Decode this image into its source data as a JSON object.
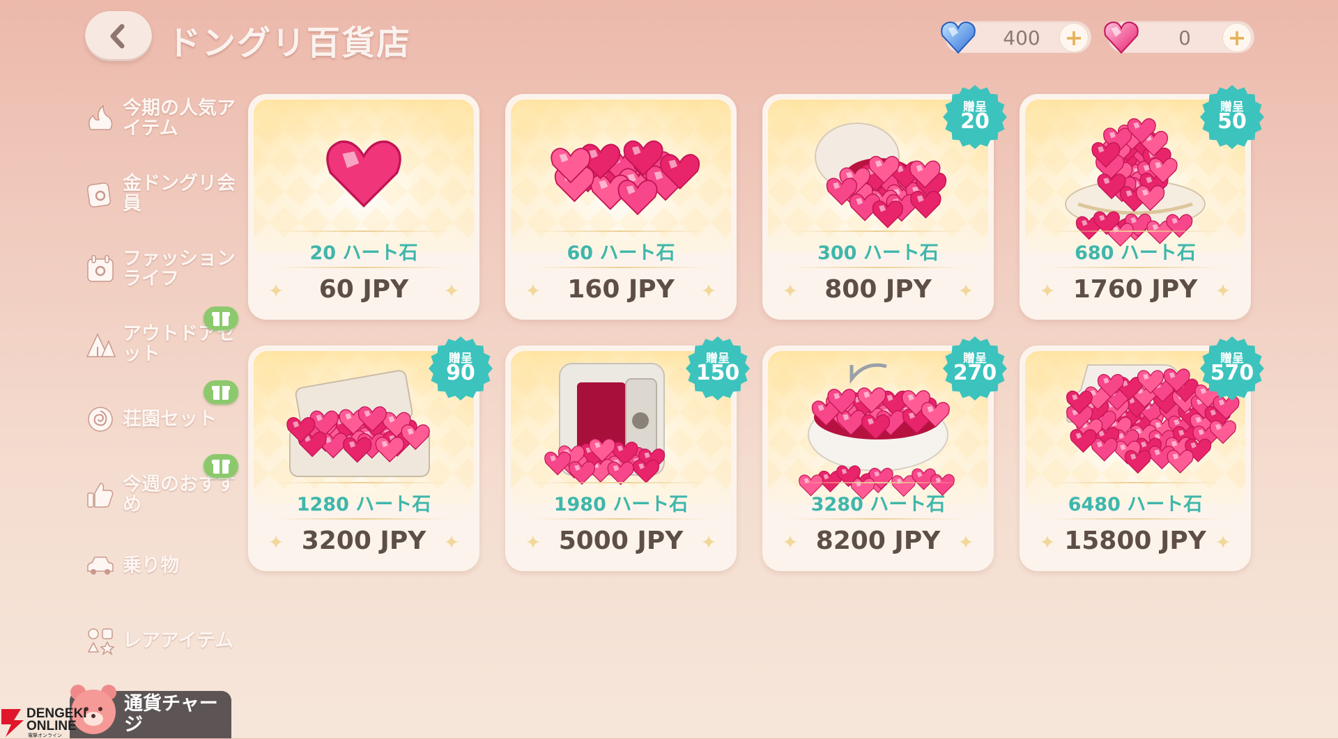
{
  "header": {
    "back_label": "",
    "title": "ドングリ百貨店",
    "currencies": [
      {
        "icon": "blue-heart-gem-icon",
        "value": "400"
      },
      {
        "icon": "pink-heart-gem-icon",
        "value": "0"
      }
    ],
    "plus_symbol": "+"
  },
  "sidebar": {
    "items": [
      {
        "label": "今期の人気アイテム",
        "icon": "popular-items-icon"
      },
      {
        "label": "金ドングリ会員",
        "icon": "gold-member-icon"
      },
      {
        "label": "ファッションライフ",
        "icon": "fashion-icon"
      },
      {
        "label": "アウトドアセット",
        "icon": "tent-icon",
        "gift": true
      },
      {
        "label": "荘園セット",
        "icon": "rose-icon",
        "gift": true
      },
      {
        "label": "今週のおすすめ",
        "icon": "thumbs-up-icon",
        "gift": true
      },
      {
        "label": "乗り物",
        "icon": "car-icon"
      },
      {
        "label": "レアアイテム",
        "icon": "rare-items-icon"
      }
    ],
    "charge_label": "通貨チャージ"
  },
  "products": [
    {
      "amount": "20 ハート石",
      "price": "60 JPY",
      "bonus_label": "",
      "bonus_value": ""
    },
    {
      "amount": "60 ハート石",
      "price": "160 JPY",
      "bonus_label": "",
      "bonus_value": ""
    },
    {
      "amount": "300 ハート石",
      "price": "800 JPY",
      "bonus_label": "贈呈",
      "bonus_value": "20"
    },
    {
      "amount": "680 ハート石",
      "price": "1760 JPY",
      "bonus_label": "贈呈",
      "bonus_value": "50"
    },
    {
      "amount": "1280 ハート石",
      "price": "3200 JPY",
      "bonus_label": "贈呈",
      "bonus_value": "90"
    },
    {
      "amount": "1980 ハート石",
      "price": "5000 JPY",
      "bonus_label": "贈呈",
      "bonus_value": "150"
    },
    {
      "amount": "3280 ハート石",
      "price": "8200 JPY",
      "bonus_label": "贈呈",
      "bonus_value": "270"
    },
    {
      "amount": "6480 ハート石",
      "price": "15800 JPY",
      "bonus_label": "贈呈",
      "bonus_value": "570"
    }
  ],
  "watermark": {
    "line1": "DENGEKI",
    "line2": "ONLINE",
    "line3": "電撃オンライン"
  },
  "colors": {
    "accent_teal": "#3fb6ab",
    "heart_pink": "#f0357a",
    "bonus_badge": "#3cc3bd"
  }
}
